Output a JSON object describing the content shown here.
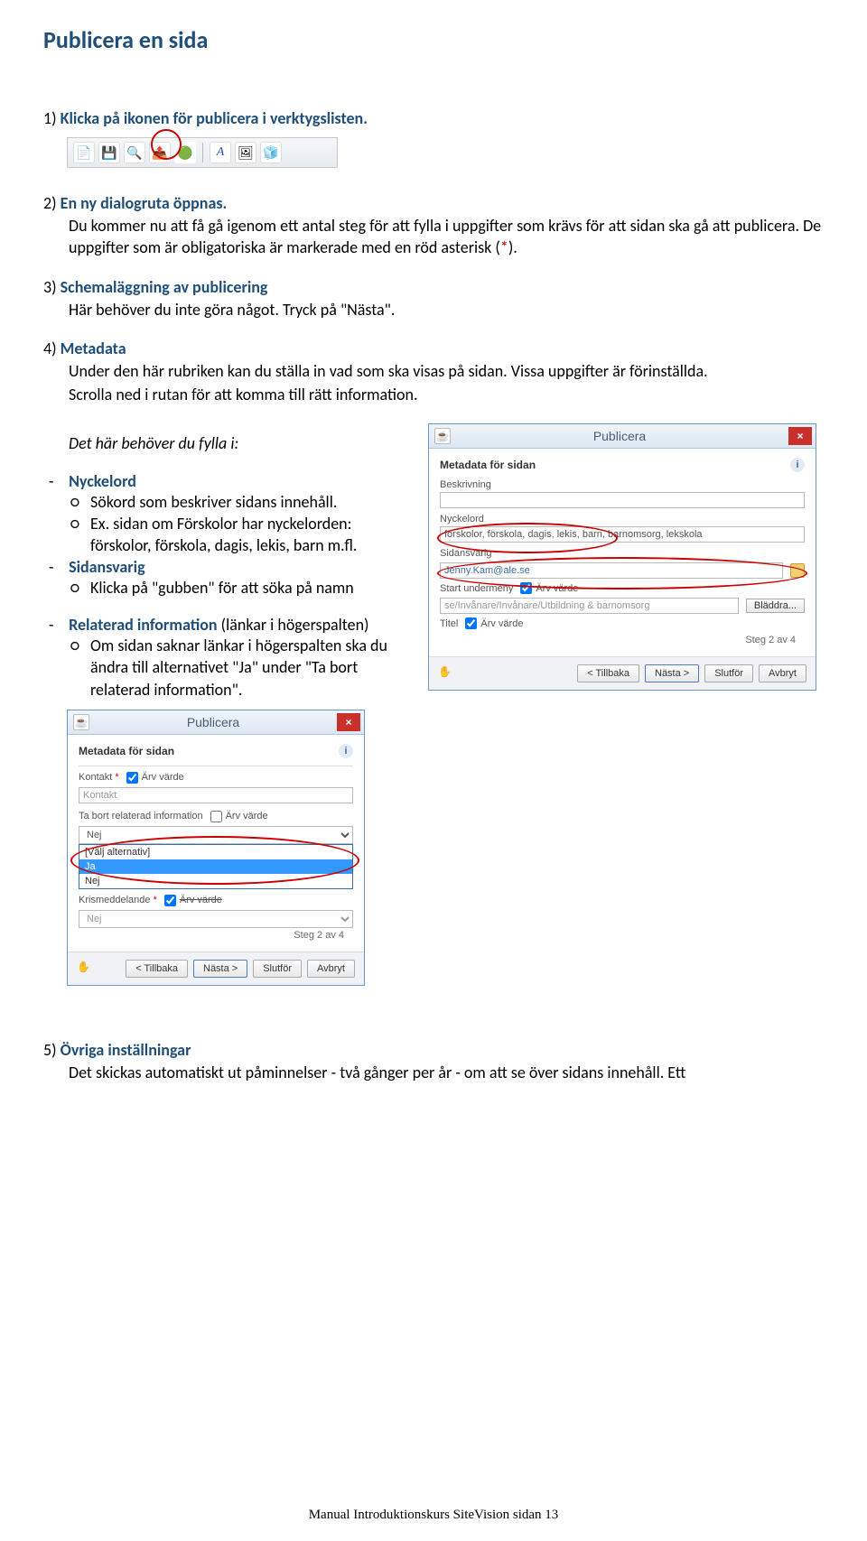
{
  "page": {
    "title": "Publicera en sida",
    "footer": "Manual Introduktionskurs SiteVision sidan 13"
  },
  "toolbar_icons": [
    "📄",
    "💾",
    "🔍",
    "📤",
    "🟢",
    "A",
    "🖼",
    "🧊"
  ],
  "steps": {
    "s1": {
      "num": "1)",
      "label": "Klicka på ikonen för publicera i verktygslisten."
    },
    "s2": {
      "num": "2)",
      "label": "En ny dialogruta öppnas.",
      "body1": "Du kommer nu att få gå igenom ett antal steg för att fylla i uppgifter som krävs för att sidan ska gå att publicera. De uppgifter som är obligatoriska är markerade med en röd asterisk (",
      "asterisk": "*",
      "body2": ")."
    },
    "s3": {
      "num": "3)",
      "label": "Schemaläggning av publicering",
      "body": "Här behöver du inte göra något. Tryck på \"Nästa\"."
    },
    "s4": {
      "num": "4)",
      "label": "Metadata",
      "body": "Under den här rubriken kan du ställa in vad som ska visas på sidan. Vissa uppgifter är förinställda.",
      "body2": "Scrolla ned i rutan för att komma till rätt information.",
      "need": "Det här behöver du fylla i:"
    },
    "nyckelord": {
      "term": "Nyckelord",
      "li1": "Sökord som beskriver sidans innehåll.",
      "li2": "Ex. sidan om Förskolor har nyckelorden: förskolor, förskola, dagis, lekis, barn m.fl."
    },
    "sidansvarig": {
      "term": "Sidansvarig",
      "li1": "Klicka på \"gubben\" för att söka på namn"
    },
    "relaterad": {
      "term": "Relaterad information",
      "suffix": " (länkar i högerspalten)",
      "li1": "Om sidan saknar länkar i högerspalten ska du ändra till alternativet \"Ja\" under \"Ta bort relaterad information\"."
    },
    "s5": {
      "num": "5)",
      "label": "Övriga inställningar",
      "body": "Det skickas automatiskt ut påminnelser - två gånger per år - om att se över sidans innehåll. Ett"
    }
  },
  "dialog1": {
    "title": "Publicera",
    "section": "Metadata för sidan",
    "beskrivning_label": "Beskrivning",
    "nyckelord_label": "Nyckelord",
    "nyckelord_value": "förskolor, förskola, dagis, lekis, barn, barnomsorg, lekskola",
    "sidansvarig_label": "Sidansvarig",
    "sidansvarig_value": "Jenny.Kam@ale.se",
    "start_label": "Start undermeny",
    "start_value": "se/Invånare/Invånare/Utbildning & barnomsorg",
    "browse": "Bläddra...",
    "titel_label": "Titel",
    "arv": "Ärv värde",
    "step_note": "Steg 2 av 4",
    "buttons": {
      "back": "< Tillbaka",
      "next": "Nästa >",
      "finish": "Slutför",
      "cancel": "Avbryt"
    }
  },
  "dialog2": {
    "title": "Publicera",
    "section": "Metadata för sidan",
    "kontakt_label": "Kontakt",
    "kontakt_value": "Kontakt",
    "tabort_label": "Ta bort relaterad information",
    "tabort_value": "Nej",
    "options": [
      "[Välj alternativ]",
      "Ja",
      "Nej"
    ],
    "krism_label": "Krismeddelande",
    "krism_value": "Nej",
    "arv": "Ärv värde",
    "step_note": "Steg 2 av 4",
    "buttons": {
      "back": "< Tillbaka",
      "next": "Nästa >",
      "finish": "Slutför",
      "cancel": "Avbryt"
    }
  }
}
